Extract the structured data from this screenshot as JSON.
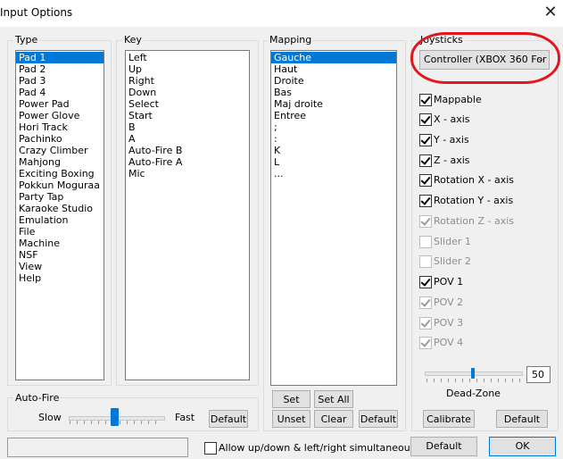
{
  "window": {
    "title": "Input Options",
    "close_glyph": "✕"
  },
  "type": {
    "label": "Type",
    "items": [
      "Pad 1",
      "Pad 2",
      "Pad 3",
      "Pad 4",
      "Power Pad",
      "Power Glove",
      "Hori Track",
      "Pachinko",
      "Crazy Climber",
      "Mahjong",
      "Exciting Boxing",
      "Pokkun Moguraa",
      "Party Tap",
      "Karaoke Studio",
      "Emulation",
      "File",
      "Machine",
      "NSF",
      "View",
      "Help"
    ],
    "selected_index": 0
  },
  "key": {
    "label": "Key",
    "items": [
      "Left",
      "Up",
      "Right",
      "Down",
      "Select",
      "Start",
      "B",
      "A",
      "Auto-Fire B",
      "Auto-Fire A",
      "Mic"
    ]
  },
  "mapping": {
    "label": "Mapping",
    "items": [
      "Gauche",
      "Haut",
      "Droite",
      "Bas",
      "Maj droite",
      "Entree",
      ";",
      ":",
      "K",
      "L",
      "..."
    ],
    "selected_index": 0,
    "buttons": {
      "set": "Set",
      "set_all": "Set All",
      "unset": "Unset",
      "clear": "Clear",
      "default": "Default"
    }
  },
  "joysticks": {
    "label": "Joysticks",
    "selected": "Controller (XBOX 360 For",
    "options": [
      {
        "label": "Mappable",
        "checked": true,
        "enabled": true
      },
      {
        "label": "X - axis",
        "checked": true,
        "enabled": true
      },
      {
        "label": "Y - axis",
        "checked": true,
        "enabled": true
      },
      {
        "label": "Z - axis",
        "checked": true,
        "enabled": true
      },
      {
        "label": "Rotation X - axis",
        "checked": true,
        "enabled": true
      },
      {
        "label": "Rotation Y - axis",
        "checked": true,
        "enabled": true
      },
      {
        "label": "Rotation Z - axis",
        "checked": true,
        "enabled": false
      },
      {
        "label": "Slider 1",
        "checked": false,
        "enabled": false
      },
      {
        "label": "Slider 2",
        "checked": false,
        "enabled": false
      },
      {
        "label": "POV 1",
        "checked": true,
        "enabled": true
      },
      {
        "label": "POV 2",
        "checked": true,
        "enabled": false
      },
      {
        "label": "POV 3",
        "checked": true,
        "enabled": false
      },
      {
        "label": "POV 4",
        "checked": true,
        "enabled": false
      }
    ],
    "deadzone_value": "50",
    "deadzone_level": 0.5,
    "deadzone_label": "Dead-Zone",
    "calibrate": "Calibrate",
    "default": "Default"
  },
  "autofire": {
    "label": "Auto-Fire",
    "slow": "Slow",
    "fast": "Fast",
    "level": 0.48,
    "default": "Default"
  },
  "footer": {
    "simultaneous_label": "Allow up/down & left/right simultaneously",
    "simultaneous_checked": false,
    "default": "Default",
    "ok": "OK"
  },
  "colors": {
    "selection": "#0078d7",
    "highlight_ring": "#e2161c",
    "dialog_bg": "#f0f0f0"
  }
}
